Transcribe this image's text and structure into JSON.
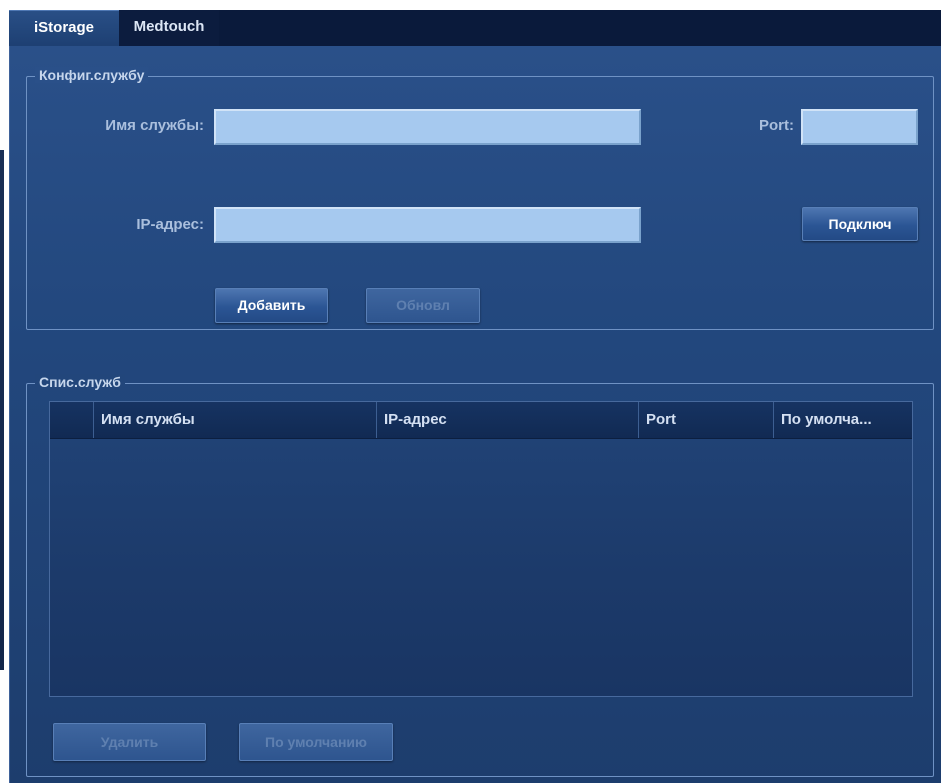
{
  "tabs": [
    {
      "label": "iStorage",
      "active": true
    },
    {
      "label": "Medtouch",
      "active": false
    }
  ],
  "config": {
    "title": "Конфиг.службу",
    "service_name_label": "Имя службы:",
    "service_name_value": "",
    "port_label": "Port:",
    "port_value": "",
    "ip_label": "IP-адрес:",
    "ip_value": "",
    "connect_button": "Подключ",
    "add_button": "Добавить",
    "update_button": "Обновл"
  },
  "services": {
    "title": "Спис.служб",
    "columns": [
      "",
      "Имя службы",
      "IP-адрес",
      "Port",
      "По умолча..."
    ],
    "rows": [],
    "delete_button": "Удалить",
    "default_button": "По умолчанию"
  },
  "colors": {
    "panel": "#22477d",
    "tabbar": "#0a1a3b",
    "field": "#a6c9ef"
  }
}
